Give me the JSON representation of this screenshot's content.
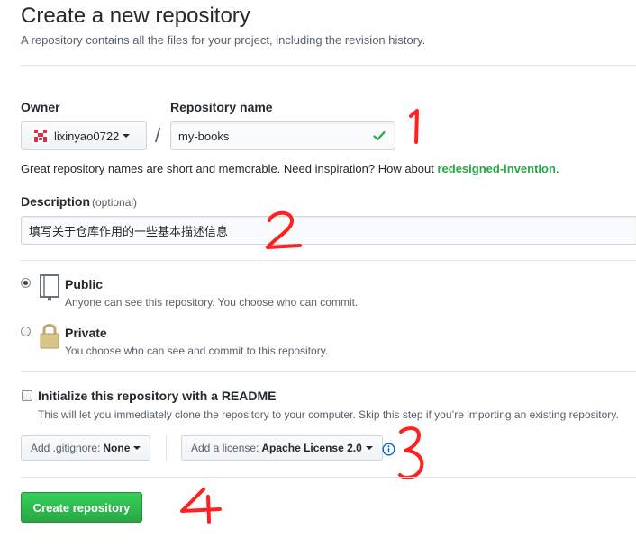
{
  "header": {
    "title": "Create a new repository",
    "subtitle": "A repository contains all the files for your project, including the revision history."
  },
  "owner": {
    "label": "Owner",
    "value": "lixinyao0722"
  },
  "repo_name": {
    "label": "Repository name",
    "value": "my-books",
    "separator": "/"
  },
  "name_hint": {
    "text": "Great repository names are short and memorable. Need inspiration? How about ",
    "suggestion": "redesigned-invention",
    "end": "."
  },
  "description": {
    "label": "Description",
    "optional": "(optional)",
    "value": "填写关于仓库作用的一些基本描述信息"
  },
  "visibility": {
    "public": {
      "label": "Public",
      "note": "Anyone can see this repository. You choose who can commit.",
      "checked": true
    },
    "private": {
      "label": "Private",
      "note": "You choose who can see and commit to this repository.",
      "checked": false
    }
  },
  "readme": {
    "label": "Initialize this repository with a README",
    "note": "This will let you immediately clone the repository to your computer. Skip this step if you’re importing an existing repository.",
    "checked": false
  },
  "gitignore": {
    "prefix": "Add .gitignore:",
    "value": "None"
  },
  "license": {
    "prefix": "Add a license:",
    "value": "Apache License 2.0"
  },
  "submit": {
    "label": "Create repository"
  },
  "annotations": [
    "1",
    "2",
    "3",
    "4"
  ],
  "colors": {
    "accent_green": "#28a745",
    "annotation_red": "#ff2020",
    "info_blue": "#0366d6"
  },
  "icons": [
    "caret-down-icon",
    "check-icon",
    "book-icon",
    "lock-icon",
    "info-icon",
    "avatar-icon"
  ]
}
